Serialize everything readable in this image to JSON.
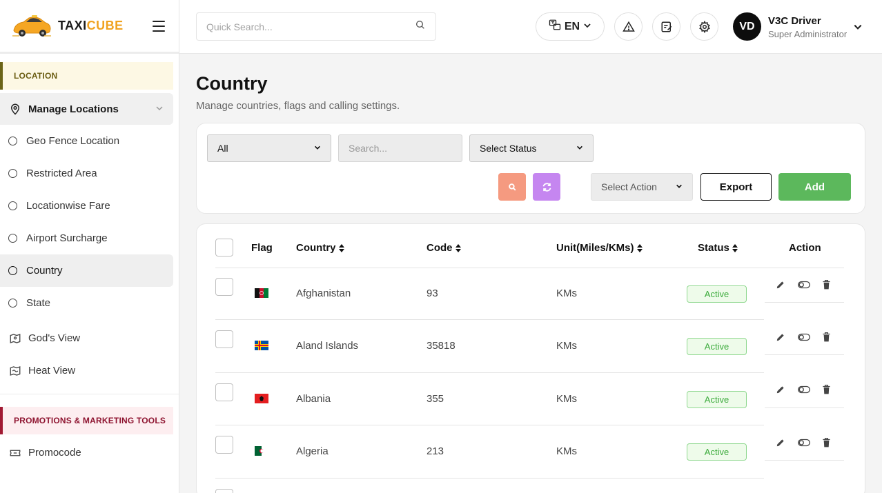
{
  "brand": {
    "name_part1": "TAXI",
    "name_part2": "CUBE"
  },
  "header": {
    "search_placeholder": "Quick Search...",
    "language": "EN",
    "user": {
      "initials": "VD",
      "name": "V3C Driver",
      "role": "Super Administrator"
    }
  },
  "sidebar": {
    "section_location": "LOCATION",
    "group_label": "Manage Locations",
    "items": [
      {
        "label": "Geo Fence Location"
      },
      {
        "label": "Restricted Area"
      },
      {
        "label": "Locationwise Fare"
      },
      {
        "label": "Airport Surcharge"
      },
      {
        "label": "Country"
      },
      {
        "label": "State"
      }
    ],
    "gods_view": "God's View",
    "heat_view": "Heat View",
    "section_promo": "PROMOTIONS & MARKETING TOOLS",
    "promocode": "Promocode"
  },
  "page": {
    "title": "Country",
    "subtitle": "Manage countries, flags and calling settings."
  },
  "filters": {
    "type_value": "All",
    "search_placeholder": "Search...",
    "status_value": "Select Status",
    "action_value": "Select Action",
    "export_label": "Export",
    "add_label": "Add"
  },
  "table": {
    "headers": {
      "flag": "Flag",
      "country": "Country",
      "code": "Code",
      "unit": "Unit(Miles/KMs)",
      "status": "Status",
      "action": "Action"
    },
    "rows": [
      {
        "country": "Afghanistan",
        "code": "93",
        "unit": "KMs",
        "status": "Active"
      },
      {
        "country": "Aland Islands",
        "code": "35818",
        "unit": "KMs",
        "status": "Active"
      },
      {
        "country": "Albania",
        "code": "355",
        "unit": "KMs",
        "status": "Active"
      },
      {
        "country": "Algeria",
        "code": "213",
        "unit": "KMs",
        "status": "Active"
      }
    ]
  },
  "colors": {
    "accent_orange": "#f0a21f",
    "add_green": "#5cb85c",
    "search_btn": "#f59a80",
    "reset_btn": "#c586f0",
    "active_badge": "#3cab3c"
  },
  "icons": [
    "hamburger-icon",
    "search-icon",
    "translate-icon",
    "chevron-down-icon",
    "warning-icon",
    "edit-note-icon",
    "gear-icon",
    "map-pin-icon",
    "map-icon",
    "heat-map-icon",
    "ticket-icon",
    "pencil-icon",
    "toggle-icon",
    "trash-icon",
    "refresh-icon"
  ]
}
